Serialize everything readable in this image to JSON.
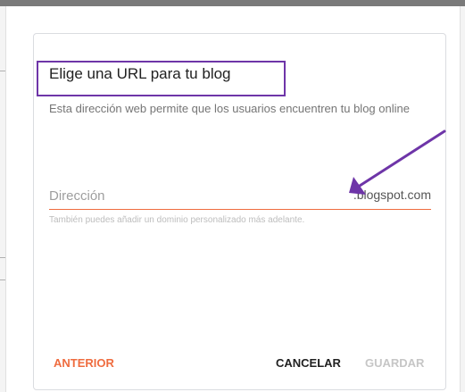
{
  "dialog": {
    "title": "Elige una URL para tu blog",
    "description": "Esta dirección web permite que los usuarios encuentren tu blog online",
    "url_field": {
      "placeholder": "Dirección",
      "value": "",
      "suffix": ".blogspot.com",
      "hint": "También puedes añadir un dominio personalizado más adelante."
    },
    "buttons": {
      "previous": "ANTERIOR",
      "cancel": "CANCELAR",
      "save": "GUARDAR"
    }
  },
  "colors": {
    "accent": "#ef6c3f",
    "annotation": "#6e35a8",
    "disabled": "#c6c6c6",
    "text": "#212121",
    "secondary_text": "#757575"
  },
  "annotations": {
    "title_highlight": "purple-rectangle",
    "arrow": "purple-arrow-pointing-to-suffix"
  }
}
